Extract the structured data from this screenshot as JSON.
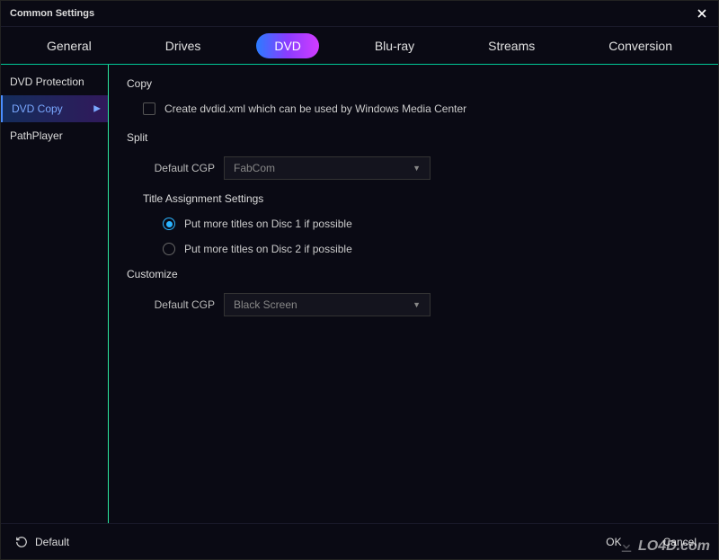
{
  "window": {
    "title": "Common Settings"
  },
  "tabs": [
    {
      "label": "General"
    },
    {
      "label": "Drives"
    },
    {
      "label": "DVD"
    },
    {
      "label": "Blu-ray"
    },
    {
      "label": "Streams"
    },
    {
      "label": "Conversion"
    }
  ],
  "sidebar": {
    "items": [
      {
        "label": "DVD Protection"
      },
      {
        "label": "DVD Copy"
      },
      {
        "label": "PathPlayer"
      }
    ]
  },
  "content": {
    "copy": {
      "title": "Copy",
      "checkbox_label": "Create dvdid.xml which can be used by Windows Media Center"
    },
    "split": {
      "title": "Split",
      "default_cgp_label": "Default CGP",
      "default_cgp_value": "FabCom",
      "title_assignment_label": "Title Assignment Settings",
      "radio1": "Put more titles on Disc 1 if possible",
      "radio2": "Put more titles on Disc 2 if possible"
    },
    "customize": {
      "title": "Customize",
      "default_cgp_label": "Default CGP",
      "default_cgp_value": "Black Screen"
    }
  },
  "footer": {
    "default": "Default",
    "ok": "OK",
    "cancel": "Cancel"
  },
  "watermark": "LO4D.com"
}
